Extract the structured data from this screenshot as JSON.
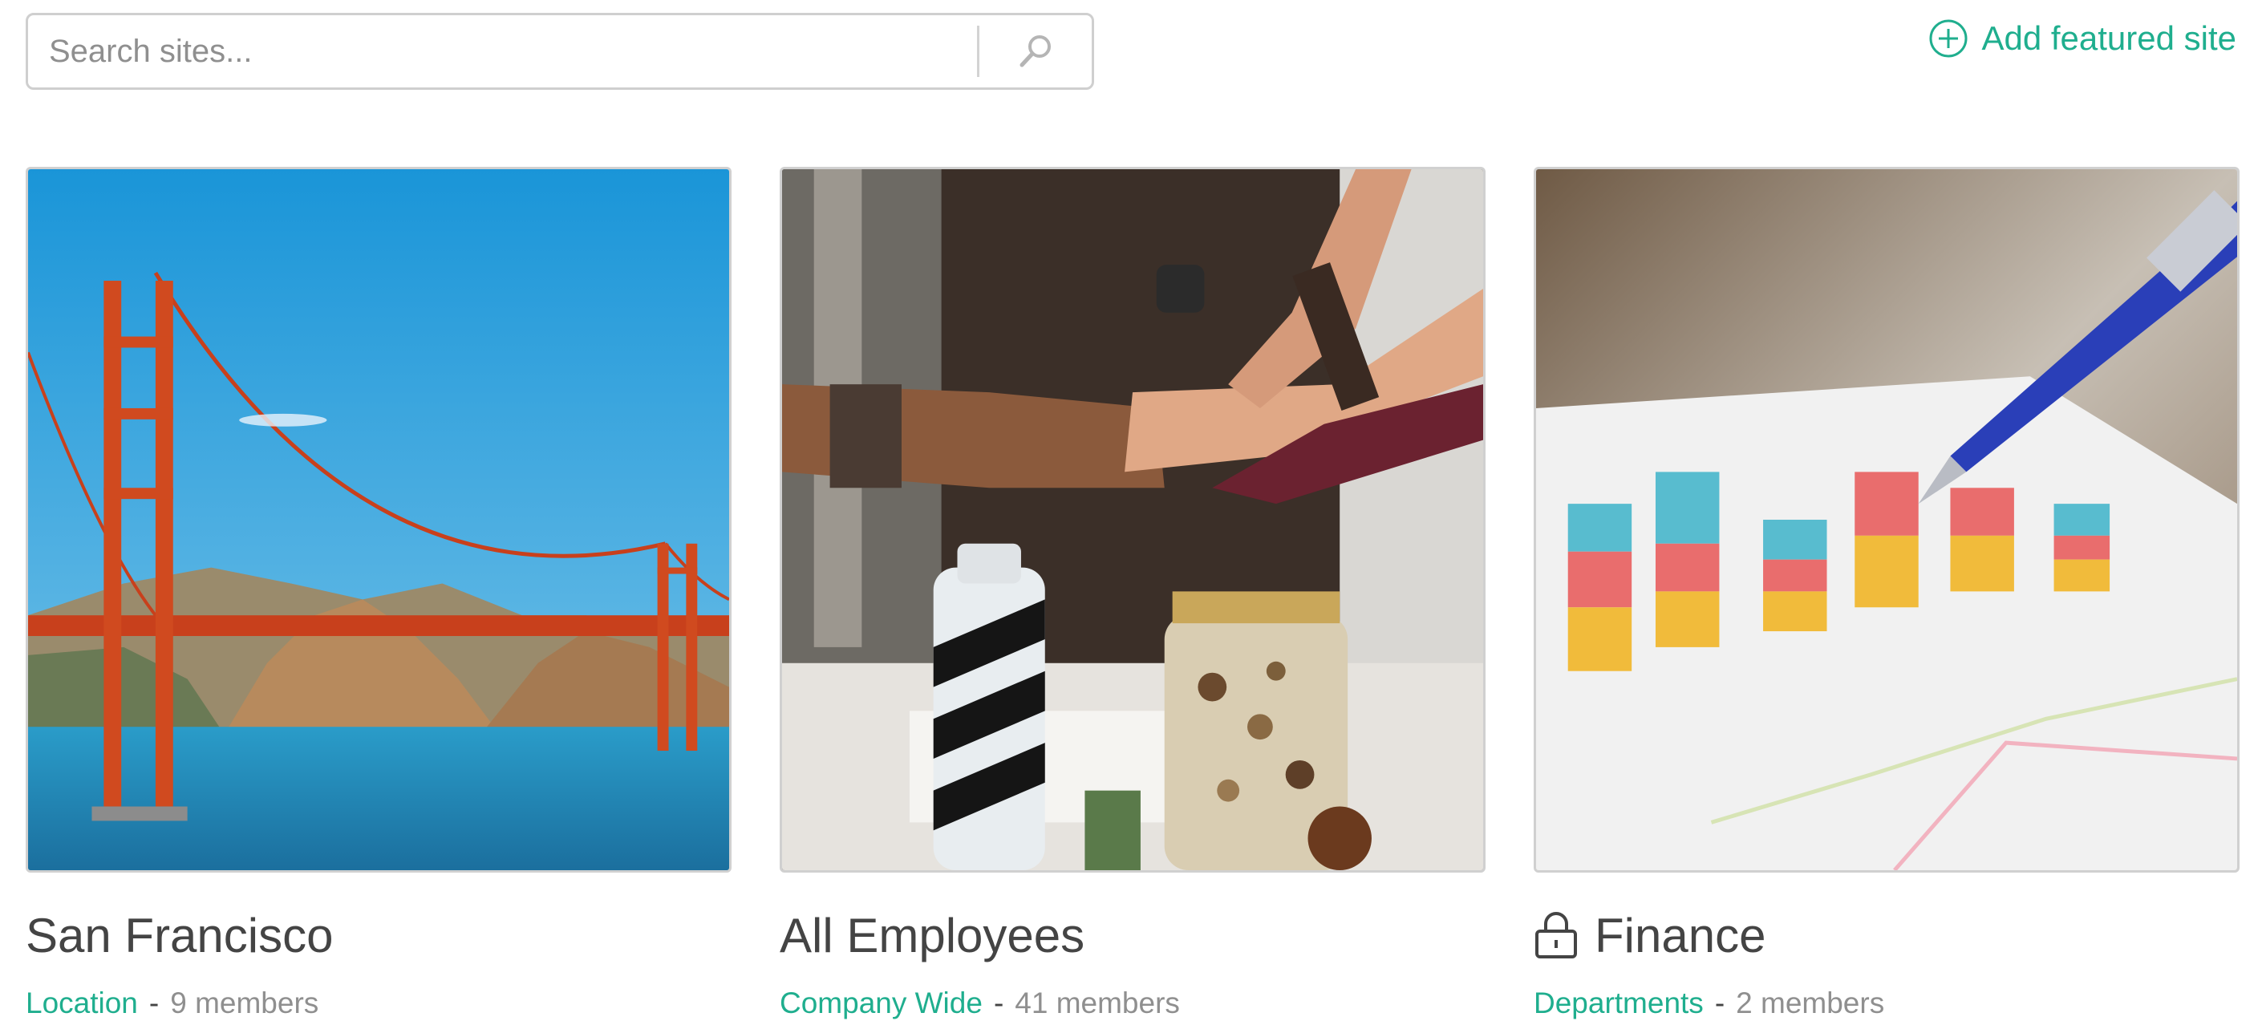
{
  "search": {
    "placeholder": "Search sites..."
  },
  "header": {
    "add_site_label": "Add featured site"
  },
  "accent_color": "#1fae8e",
  "cards": [
    {
      "title": "San Francisco",
      "category": "Location",
      "separator": "-",
      "members": "9 members",
      "locked": false,
      "image": "golden-gate-bridge"
    },
    {
      "title": "All Employees",
      "category": "Company Wide",
      "separator": "-",
      "members": "41 members",
      "locked": false,
      "image": "team-fist-bump"
    },
    {
      "title": "Finance",
      "category": "Departments",
      "separator": "-",
      "members": "2 members",
      "locked": true,
      "icon": "lock-icon",
      "image": "bar-chart-with-pen"
    }
  ]
}
